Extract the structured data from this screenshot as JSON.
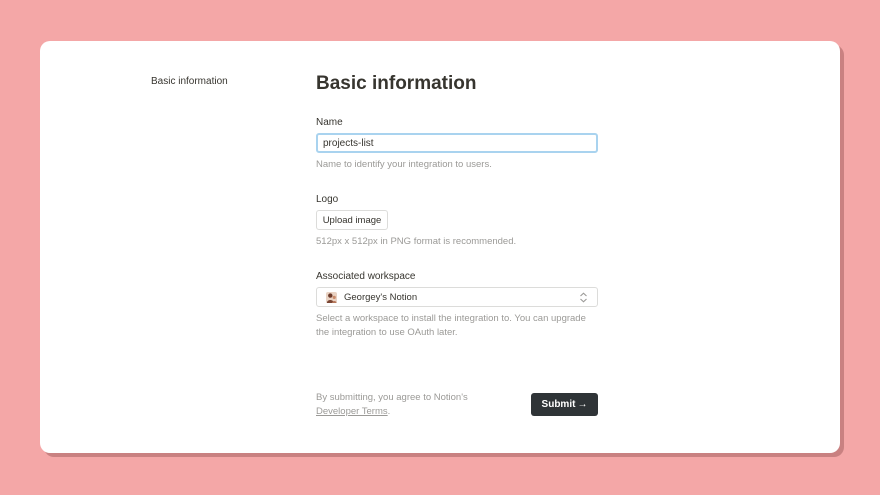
{
  "sidebar": {
    "items": [
      {
        "label": "Basic information"
      }
    ]
  },
  "form": {
    "title": "Basic information",
    "name": {
      "label": "Name",
      "value": "projects-list",
      "hint": "Name to identify your integration to users."
    },
    "logo": {
      "label": "Logo",
      "button_label": "Upload image",
      "hint": "512px x 512px in PNG format is recommended."
    },
    "workspace": {
      "label": "Associated workspace",
      "selected": "Georgey's Notion",
      "hint": "Select a workspace to install the integration to. You can upgrade the integration to use OAuth later."
    },
    "footer": {
      "terms_prefix": "By submitting, you agree to Notion's",
      "terms_link": "Developer Terms",
      "terms_suffix": ".",
      "submit_label": "Submit",
      "submit_arrow": "→"
    }
  },
  "colors": {
    "background": "#f4a7a7",
    "card": "#ffffff",
    "input_focus_border": "#a9d3ef",
    "submit_bg": "#2f3437",
    "hint_text": "#9b9a97"
  },
  "icons": {
    "workspace_avatar": "avatar-icon",
    "select_toggle": "chevron-up-down-icon",
    "submit_arrow": "arrow-right-icon"
  }
}
